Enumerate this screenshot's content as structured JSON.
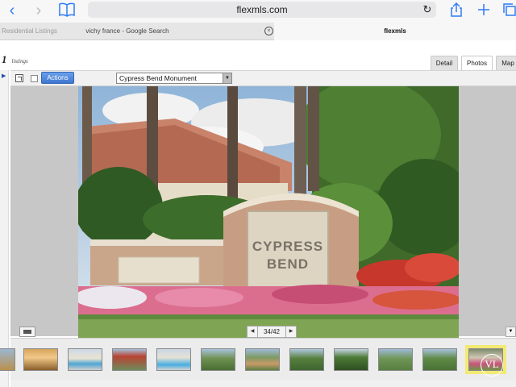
{
  "browser": {
    "back_glyph": "‹",
    "forward_glyph": "›",
    "url": "flexmls.com",
    "reload_glyph": "↻",
    "tabs": [
      {
        "label": "Residential Listings"
      },
      {
        "label": "vichy france - Google Search"
      },
      {
        "label": "flexmls"
      }
    ],
    "tab_close_glyph": "×"
  },
  "page": {
    "listing_count": "1",
    "listing_label": "listings",
    "view_tabs": [
      {
        "label": "Detail"
      },
      {
        "label": "Photos"
      },
      {
        "label": "Map"
      }
    ],
    "actions_label": "Actions",
    "photo_select_value": "Cypress Bend Monument",
    "pager": {
      "current": 34,
      "total": 42,
      "text": "34/42"
    },
    "sign_line1": "CYPRESS",
    "sign_line2": "BEND",
    "logo_text": "VL"
  },
  "colors": {
    "link_blue": "#2f7cf6",
    "actions_blue": "#3f76d0",
    "selected_thumb": "#f3ea73"
  },
  "icons": {
    "back": "chevron-left-icon",
    "forward": "chevron-right-icon",
    "bookmarks": "book-icon",
    "share": "share-icon",
    "new_tab": "plus-icon",
    "tabs": "tabs-icon",
    "expand": "expand-icon",
    "screen": "screen-icon"
  }
}
